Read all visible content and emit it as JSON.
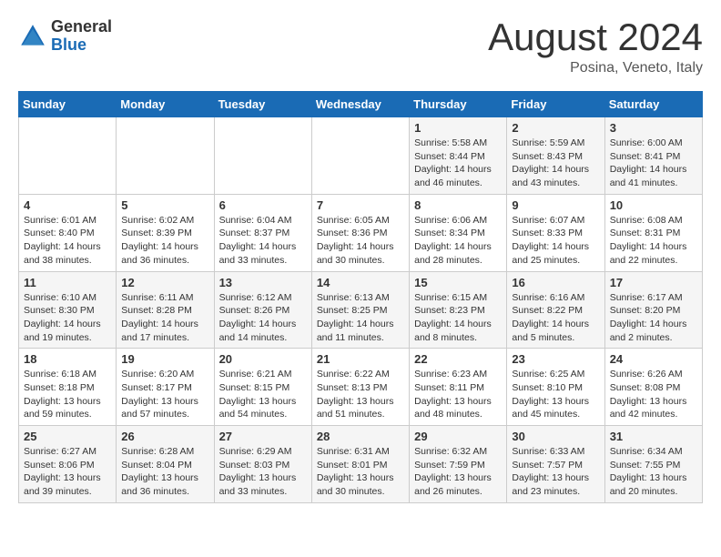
{
  "logo": {
    "general": "General",
    "blue": "Blue"
  },
  "title": "August 2024",
  "location": "Posina, Veneto, Italy",
  "days_of_week": [
    "Sunday",
    "Monday",
    "Tuesday",
    "Wednesday",
    "Thursday",
    "Friday",
    "Saturday"
  ],
  "weeks": [
    [
      {
        "day": "",
        "info": ""
      },
      {
        "day": "",
        "info": ""
      },
      {
        "day": "",
        "info": ""
      },
      {
        "day": "",
        "info": ""
      },
      {
        "day": "1",
        "info": "Sunrise: 5:58 AM\nSunset: 8:44 PM\nDaylight: 14 hours\nand 46 minutes."
      },
      {
        "day": "2",
        "info": "Sunrise: 5:59 AM\nSunset: 8:43 PM\nDaylight: 14 hours\nand 43 minutes."
      },
      {
        "day": "3",
        "info": "Sunrise: 6:00 AM\nSunset: 8:41 PM\nDaylight: 14 hours\nand 41 minutes."
      }
    ],
    [
      {
        "day": "4",
        "info": "Sunrise: 6:01 AM\nSunset: 8:40 PM\nDaylight: 14 hours\nand 38 minutes."
      },
      {
        "day": "5",
        "info": "Sunrise: 6:02 AM\nSunset: 8:39 PM\nDaylight: 14 hours\nand 36 minutes."
      },
      {
        "day": "6",
        "info": "Sunrise: 6:04 AM\nSunset: 8:37 PM\nDaylight: 14 hours\nand 33 minutes."
      },
      {
        "day": "7",
        "info": "Sunrise: 6:05 AM\nSunset: 8:36 PM\nDaylight: 14 hours\nand 30 minutes."
      },
      {
        "day": "8",
        "info": "Sunrise: 6:06 AM\nSunset: 8:34 PM\nDaylight: 14 hours\nand 28 minutes."
      },
      {
        "day": "9",
        "info": "Sunrise: 6:07 AM\nSunset: 8:33 PM\nDaylight: 14 hours\nand 25 minutes."
      },
      {
        "day": "10",
        "info": "Sunrise: 6:08 AM\nSunset: 8:31 PM\nDaylight: 14 hours\nand 22 minutes."
      }
    ],
    [
      {
        "day": "11",
        "info": "Sunrise: 6:10 AM\nSunset: 8:30 PM\nDaylight: 14 hours\nand 19 minutes."
      },
      {
        "day": "12",
        "info": "Sunrise: 6:11 AM\nSunset: 8:28 PM\nDaylight: 14 hours\nand 17 minutes."
      },
      {
        "day": "13",
        "info": "Sunrise: 6:12 AM\nSunset: 8:26 PM\nDaylight: 14 hours\nand 14 minutes."
      },
      {
        "day": "14",
        "info": "Sunrise: 6:13 AM\nSunset: 8:25 PM\nDaylight: 14 hours\nand 11 minutes."
      },
      {
        "day": "15",
        "info": "Sunrise: 6:15 AM\nSunset: 8:23 PM\nDaylight: 14 hours\nand 8 minutes."
      },
      {
        "day": "16",
        "info": "Sunrise: 6:16 AM\nSunset: 8:22 PM\nDaylight: 14 hours\nand 5 minutes."
      },
      {
        "day": "17",
        "info": "Sunrise: 6:17 AM\nSunset: 8:20 PM\nDaylight: 14 hours\nand 2 minutes."
      }
    ],
    [
      {
        "day": "18",
        "info": "Sunrise: 6:18 AM\nSunset: 8:18 PM\nDaylight: 13 hours\nand 59 minutes."
      },
      {
        "day": "19",
        "info": "Sunrise: 6:20 AM\nSunset: 8:17 PM\nDaylight: 13 hours\nand 57 minutes."
      },
      {
        "day": "20",
        "info": "Sunrise: 6:21 AM\nSunset: 8:15 PM\nDaylight: 13 hours\nand 54 minutes."
      },
      {
        "day": "21",
        "info": "Sunrise: 6:22 AM\nSunset: 8:13 PM\nDaylight: 13 hours\nand 51 minutes."
      },
      {
        "day": "22",
        "info": "Sunrise: 6:23 AM\nSunset: 8:11 PM\nDaylight: 13 hours\nand 48 minutes."
      },
      {
        "day": "23",
        "info": "Sunrise: 6:25 AM\nSunset: 8:10 PM\nDaylight: 13 hours\nand 45 minutes."
      },
      {
        "day": "24",
        "info": "Sunrise: 6:26 AM\nSunset: 8:08 PM\nDaylight: 13 hours\nand 42 minutes."
      }
    ],
    [
      {
        "day": "25",
        "info": "Sunrise: 6:27 AM\nSunset: 8:06 PM\nDaylight: 13 hours\nand 39 minutes."
      },
      {
        "day": "26",
        "info": "Sunrise: 6:28 AM\nSunset: 8:04 PM\nDaylight: 13 hours\nand 36 minutes."
      },
      {
        "day": "27",
        "info": "Sunrise: 6:29 AM\nSunset: 8:03 PM\nDaylight: 13 hours\nand 33 minutes."
      },
      {
        "day": "28",
        "info": "Sunrise: 6:31 AM\nSunset: 8:01 PM\nDaylight: 13 hours\nand 30 minutes."
      },
      {
        "day": "29",
        "info": "Sunrise: 6:32 AM\nSunset: 7:59 PM\nDaylight: 13 hours\nand 26 minutes."
      },
      {
        "day": "30",
        "info": "Sunrise: 6:33 AM\nSunset: 7:57 PM\nDaylight: 13 hours\nand 23 minutes."
      },
      {
        "day": "31",
        "info": "Sunrise: 6:34 AM\nSunset: 7:55 PM\nDaylight: 13 hours\nand 20 minutes."
      }
    ]
  ]
}
